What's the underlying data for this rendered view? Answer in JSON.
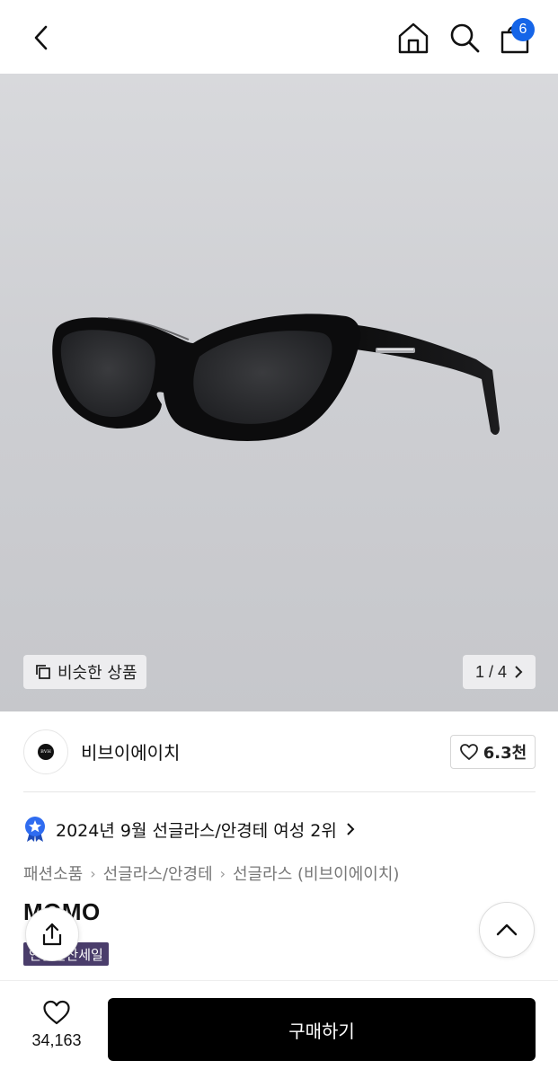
{
  "header": {
    "back_icon": "chevron-left-icon",
    "home_icon": "home-icon",
    "search_icon": "search-icon",
    "cart_icon": "shopping-bag-icon",
    "cart_count": "6",
    "badge_color": "#1565e8"
  },
  "gallery": {
    "image_subject": "black oval sunglasses",
    "similar_label": "비슷한 상품",
    "pager": "1 / 4"
  },
  "brand": {
    "name": "비브이에이치",
    "like_count": "6.3천"
  },
  "ranking": {
    "text": "2024년 9월 선글라스/안경테 여성 2위"
  },
  "breadcrumb": [
    "패션소품",
    "선글라스/안경테",
    "선글라스 (비브이에이치)"
  ],
  "product": {
    "title": "MOMO",
    "sale_badge": "연말결산세일",
    "badge_color": "#4a3d6b"
  },
  "bottom_bar": {
    "wish_count": "34,163",
    "buy_label": "구매하기"
  }
}
